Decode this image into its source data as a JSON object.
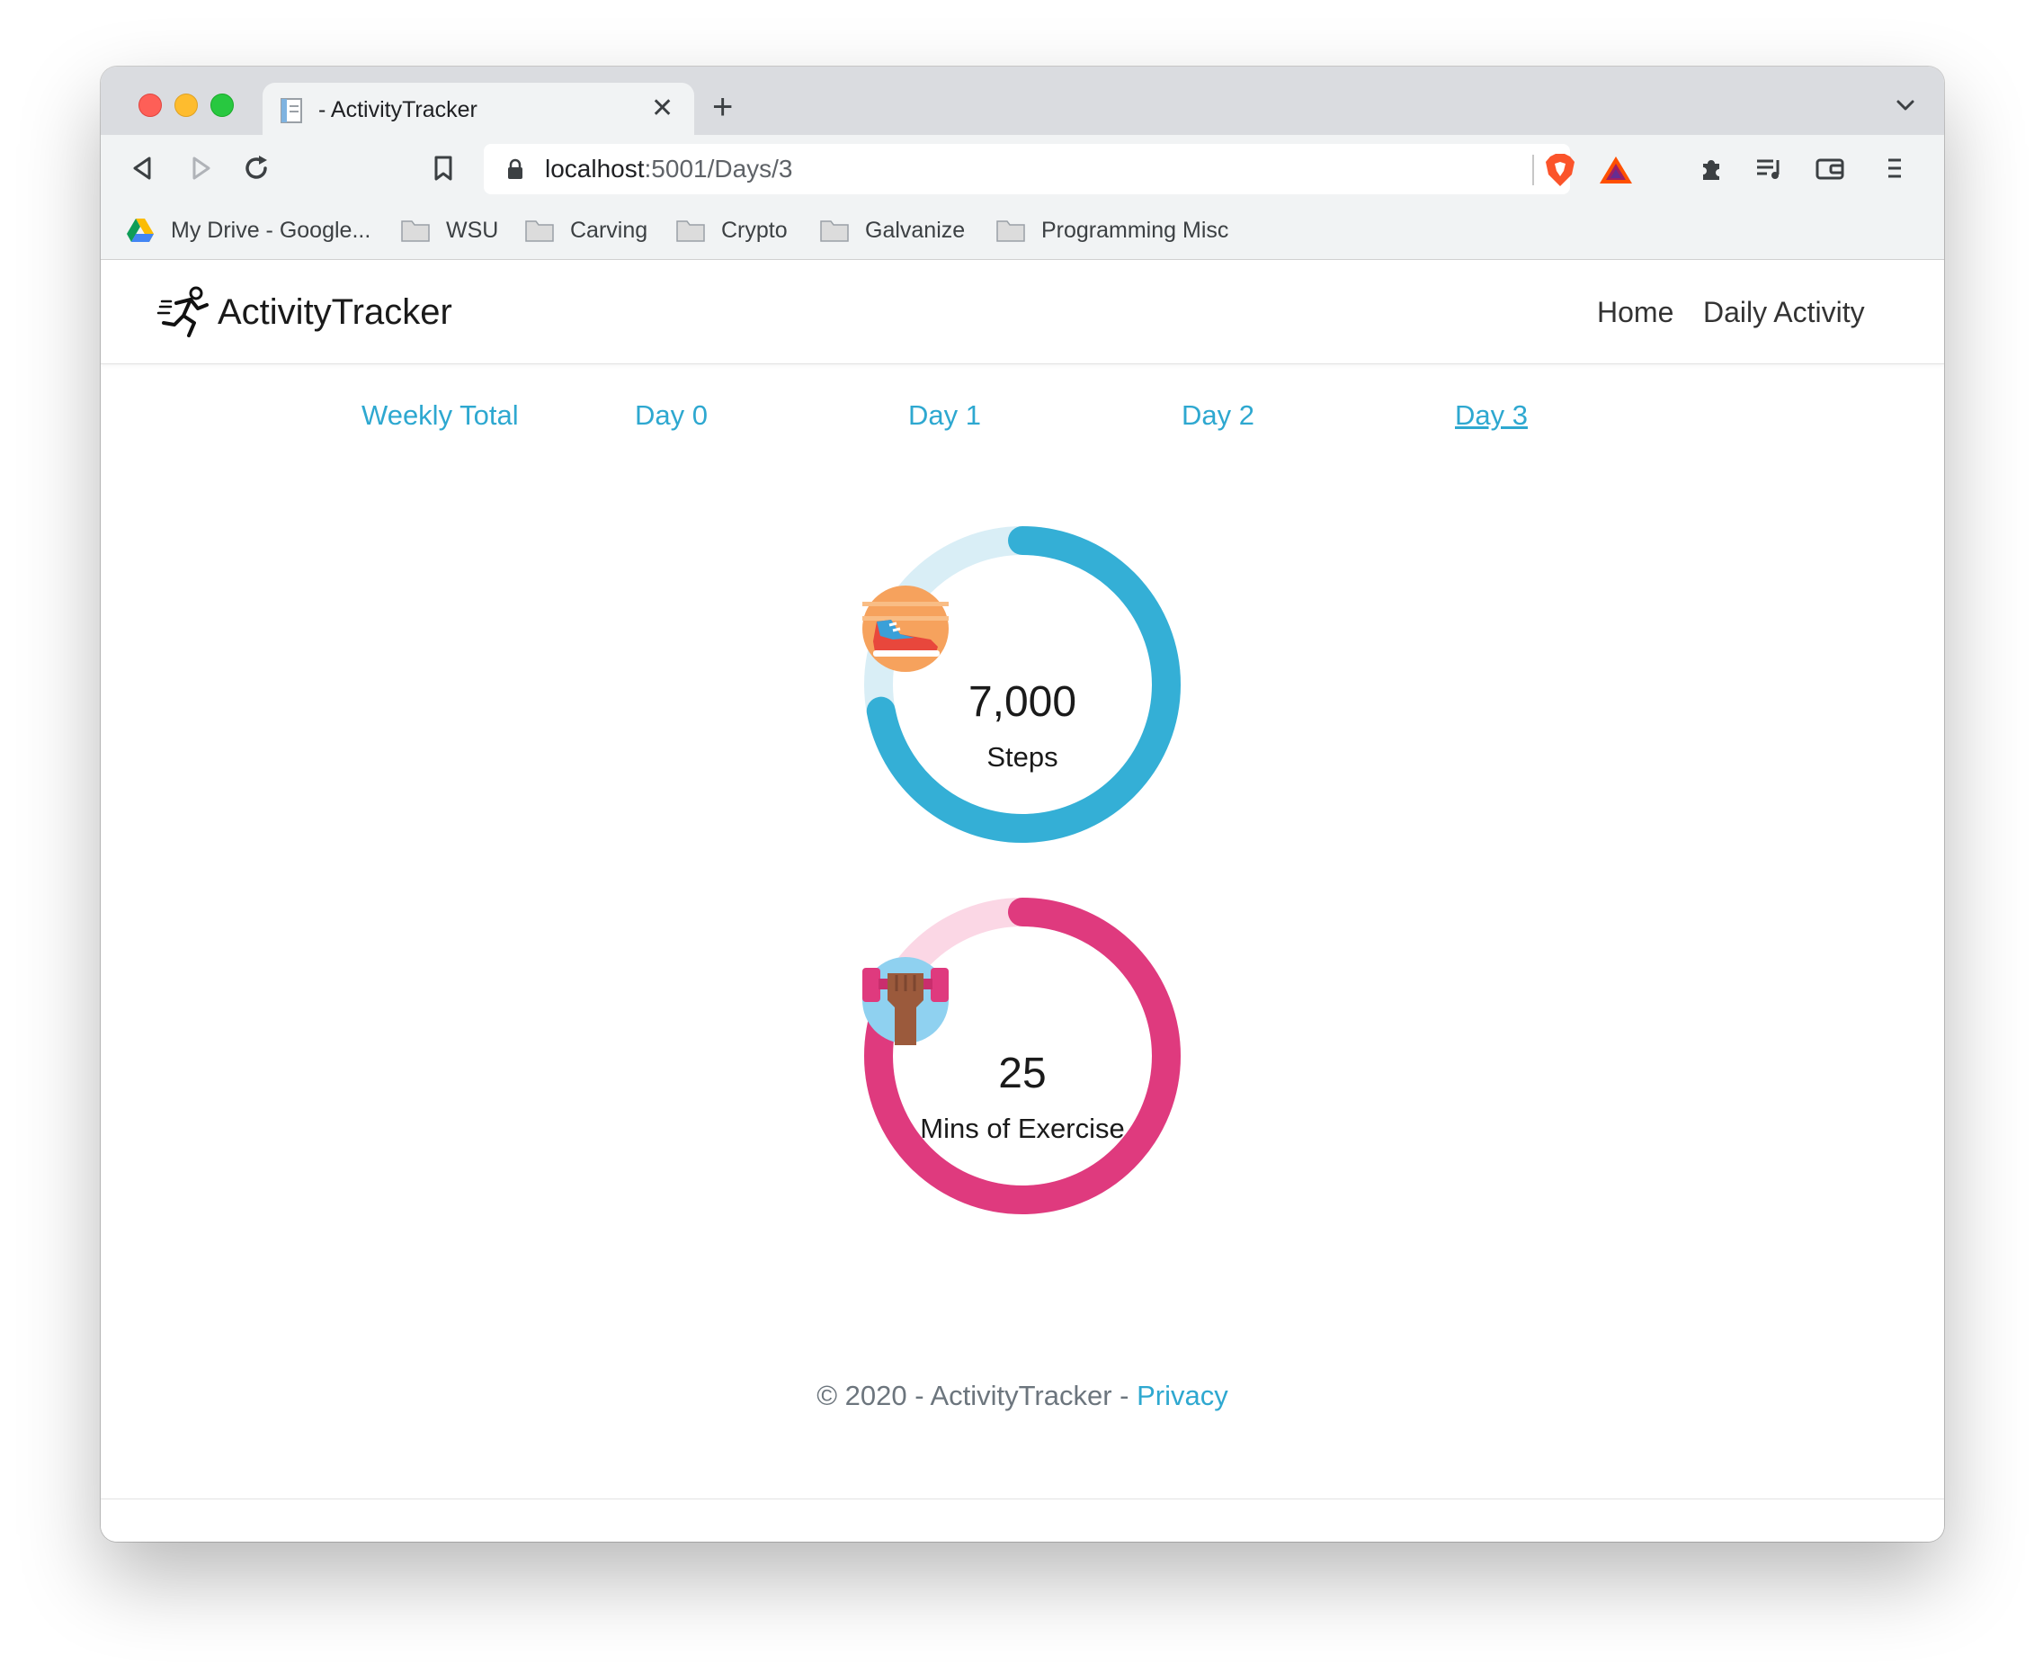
{
  "browser": {
    "tab_title": "- ActivityTracker",
    "url_host": "localhost",
    "url_path": ":5001/Days/3",
    "bookmarks": [
      {
        "label": "My Drive - Google...",
        "icon": "google-drive-icon"
      },
      {
        "label": "WSU",
        "icon": "folder-icon"
      },
      {
        "label": "Carving",
        "icon": "folder-icon"
      },
      {
        "label": "Crypto",
        "icon": "folder-icon"
      },
      {
        "label": "Galvanize",
        "icon": "folder-icon"
      },
      {
        "label": "Programming Misc",
        "icon": "folder-icon"
      }
    ]
  },
  "navbar": {
    "brand": "ActivityTracker",
    "links": [
      "Home",
      "Daily Activity"
    ]
  },
  "day_tabs": {
    "items": [
      "Weekly Total",
      "Day 0",
      "Day 1",
      "Day 2",
      "Day 3"
    ],
    "active": "Day 3"
  },
  "metrics": [
    {
      "value": "7,000",
      "label": "Steps",
      "progress": 0.72,
      "color": "#34afd6",
      "track_color": "#d9eef6",
      "icon": "sneaker-icon"
    },
    {
      "value": "25",
      "label": "Mins of Exercise",
      "progress": 0.83,
      "color": "#df3a7e",
      "track_color": "#fbd7e5",
      "icon": "dumbbell-icon"
    }
  ],
  "footer": {
    "text": "© 2020 - ActivityTracker - ",
    "link": "Privacy"
  },
  "colors": {
    "accent": "#2ea8d0"
  }
}
